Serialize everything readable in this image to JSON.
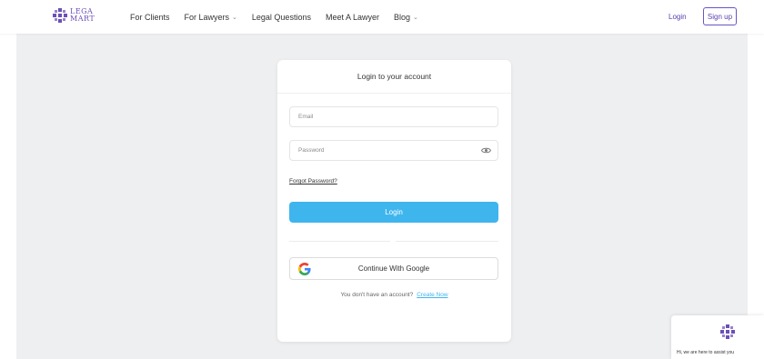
{
  "brand": {
    "line1": "LEGA",
    "line2": "MART",
    "color": "#6b4fb6"
  },
  "nav": {
    "items": [
      {
        "label": "For Clients",
        "dropdown": false
      },
      {
        "label": "For Lawyers",
        "dropdown": true
      },
      {
        "label": "Legal Questions",
        "dropdown": false
      },
      {
        "label": "Meet A Lawyer",
        "dropdown": false
      },
      {
        "label": "Blog",
        "dropdown": true
      }
    ],
    "login_label": "Login",
    "signup_label": "Sign up"
  },
  "login_form": {
    "title": "Login to your account",
    "email_placeholder": "Email",
    "password_placeholder": "Password",
    "forgot_label": "Forgot Password?",
    "login_button_label": "Login",
    "google_button_label": "Continue With Google",
    "no_account_text": "You don't have an account?",
    "create_link_label": "Create Now"
  },
  "chat_widget": {
    "message": "Hi, we are here to assist you"
  },
  "colors": {
    "accent_blue": "#3fb5ee",
    "brand_purple": "#5a3fb0",
    "background": "#eeeff1"
  },
  "icons": {
    "password_toggle": "eye-icon",
    "google": "google-icon",
    "dropdown": "chevron-down-icon"
  }
}
